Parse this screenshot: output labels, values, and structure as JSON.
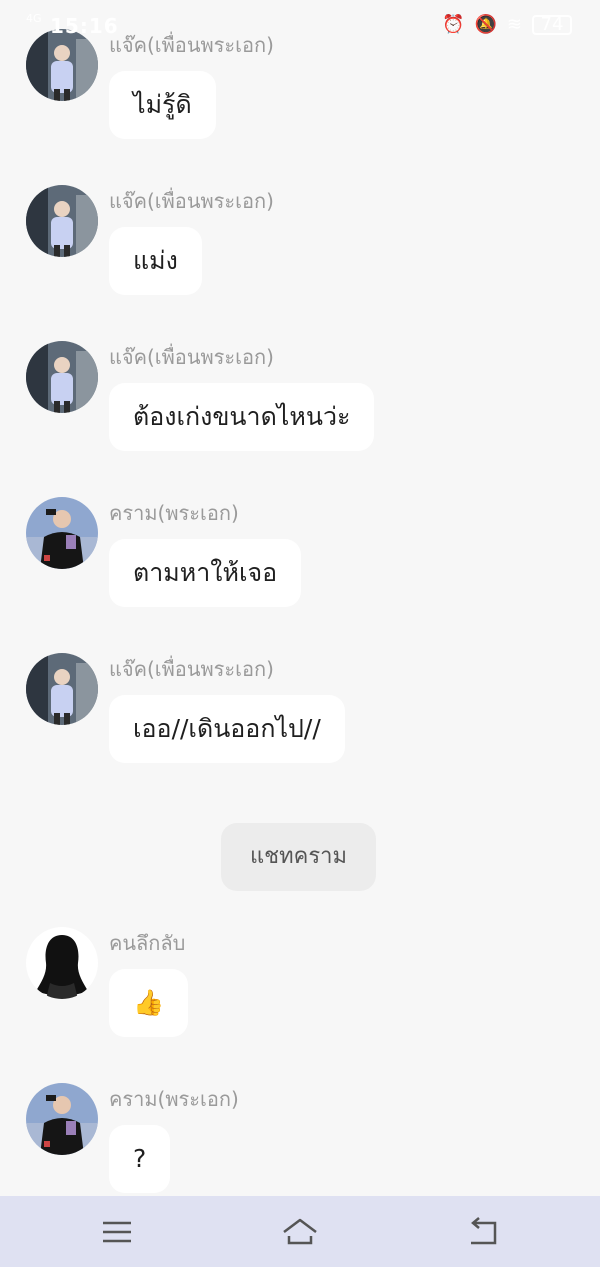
{
  "status_bar": {
    "time": "15:16",
    "signal": "4G",
    "battery": "74",
    "icons": [
      "alarm-icon",
      "mute-icon",
      "wifi-icon",
      "battery-icon"
    ]
  },
  "messages": [
    {
      "sender": "แจ๊ค(เพื่อนพระเอก)",
      "text": "ไม่รู้ดิ",
      "avatar": "jack-avatar"
    },
    {
      "sender": "แจ๊ค(เพื่อนพระเอก)",
      "text": "แม่ง",
      "avatar": "jack-avatar"
    },
    {
      "sender": "แจ๊ค(เพื่อนพระเอก)",
      "text": "ต้องเก่งขนาดไหนว่ะ",
      "avatar": "jack-avatar"
    },
    {
      "sender": "คราม(พระเอก)",
      "text": "ตามหาให้เจอ",
      "avatar": "khram-avatar"
    },
    {
      "sender": "แจ๊ค(เพื่อนพระเอก)",
      "text": "เออ//เดินออกไป//",
      "avatar": "jack-avatar"
    },
    {
      "sender": "คนลึกลับ",
      "text": "👍",
      "avatar": "mystery-avatar"
    },
    {
      "sender": "คราม(พระเอก)",
      "text": "?",
      "avatar": "khram-avatar"
    }
  ],
  "system_button": {
    "label": "แชทคราม"
  },
  "nav": {
    "items": [
      "menu-icon",
      "home-icon",
      "back-icon"
    ]
  },
  "colors": {
    "background": "#f7f7f7",
    "bubble": "#ffffff",
    "sender_text": "#9a9a9a",
    "nav_bar": "#dfe1f2"
  }
}
